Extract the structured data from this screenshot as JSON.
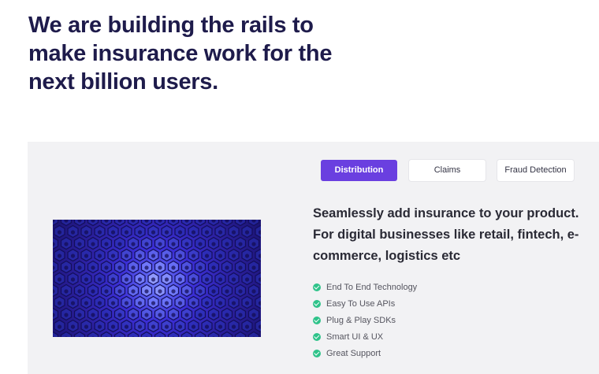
{
  "hero": {
    "heading": "We are building the rails to make insurance work for the next billion users."
  },
  "tabs": [
    {
      "label": "Distribution",
      "active": true
    },
    {
      "label": "Claims",
      "active": false
    },
    {
      "label": "Fraud Detection",
      "active": false
    }
  ],
  "feature": {
    "heading": "Seamlessly add insurance to your product. For digital businesses like retail, fintech, e-commerce, logistics etc",
    "items": [
      {
        "label": "End To End Technology",
        "icon": "check-circle-icon"
      },
      {
        "label": "Easy To Use APIs",
        "icon": "check-circle-icon"
      },
      {
        "label": "Plug & Play SDKs",
        "icon": "check-circle-icon"
      },
      {
        "label": "Smart UI & UX",
        "icon": "check-circle-icon"
      },
      {
        "label": "Great Support",
        "icon": "check-circle-icon"
      }
    ]
  },
  "colors": {
    "heading": "#1e1b4b",
    "accent": "#6a3fe0",
    "check": "#2fc38a",
    "panel_bg": "#f2f2f4"
  }
}
